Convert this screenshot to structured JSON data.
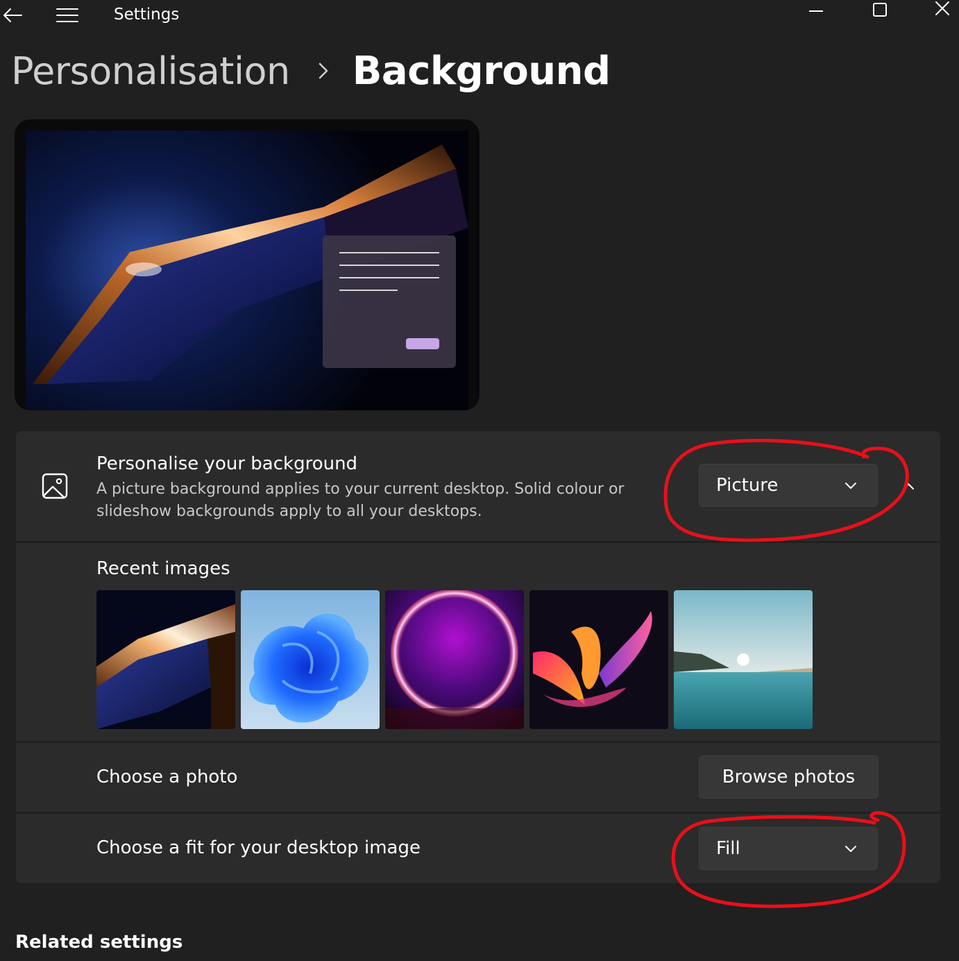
{
  "titlebar": {
    "app_title": "Settings",
    "back_icon": "back-arrow-icon",
    "menu_icon": "hamburger-menu-icon",
    "window_controls": [
      "minimize-icon",
      "maximize-icon",
      "close-icon"
    ]
  },
  "breadcrumb": {
    "parent": "Personalisation",
    "separator_icon": "chevron-right-icon",
    "current": "Background"
  },
  "preview": {
    "description_icon": "desktop-preview",
    "accent_button_color": "#c6a6e6"
  },
  "personalise": {
    "icon": "picture-icon",
    "title": "Personalise your background",
    "description": "A picture background applies to your current desktop. Solid colour or slideshow backgrounds apply to all your desktops.",
    "dropdown_value": "Picture",
    "expand_icon": "chevron-up-icon"
  },
  "recent_images": {
    "label": "Recent images",
    "items": [
      {
        "name": "recent-image-1",
        "theme": "copper-folds"
      },
      {
        "name": "recent-image-2",
        "theme": "blue-bloom"
      },
      {
        "name": "recent-image-3",
        "theme": "purple-glow"
      },
      {
        "name": "recent-image-4",
        "theme": "colorful-ribbons"
      },
      {
        "name": "recent-image-5",
        "theme": "lake-sunrise"
      }
    ]
  },
  "choose_photo": {
    "label": "Choose a photo",
    "button": "Browse photos"
  },
  "fit": {
    "label": "Choose a fit for your desktop image",
    "dropdown_value": "Fill"
  },
  "related": {
    "heading": "Related settings"
  },
  "colors": {
    "background": "#202020",
    "card": "#2b2b2b",
    "control": "#373737",
    "annotation": "#e8101a"
  }
}
